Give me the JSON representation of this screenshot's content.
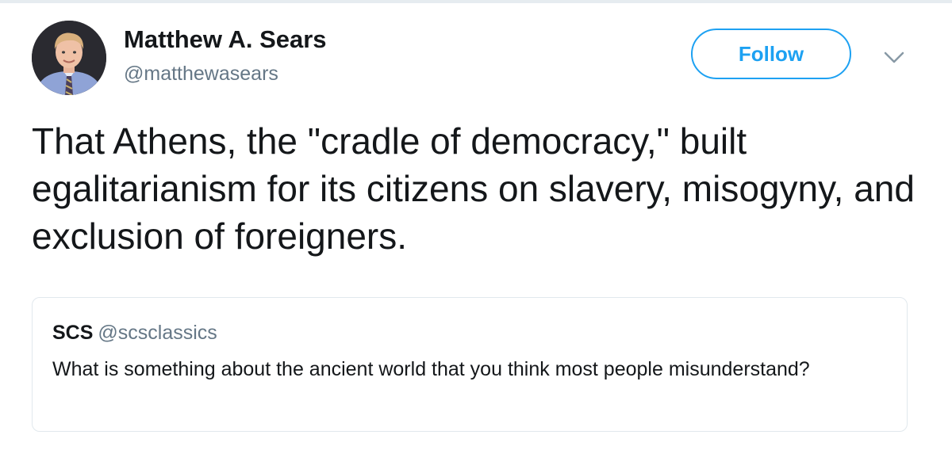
{
  "tweet": {
    "author": {
      "display_name": "Matthew A. Sears",
      "handle": "@matthewasears",
      "avatar_icon": "profile-photo"
    },
    "follow_label": "Follow",
    "more_icon": "chevron-down-icon",
    "text": "That Athens, the \"cradle of democracy,\" built egalitarianism for its citizens on slavery, misogyny, and exclusion of foreigners.",
    "quoted": {
      "display_name": "SCS",
      "handle": "@scsclassics",
      "text": "What is something about the ancient world that you think most people misunderstand?"
    }
  },
  "colors": {
    "accent": "#1da1f2",
    "text_primary": "#14171a",
    "text_secondary": "#657786",
    "border": "#e1e8ed"
  }
}
